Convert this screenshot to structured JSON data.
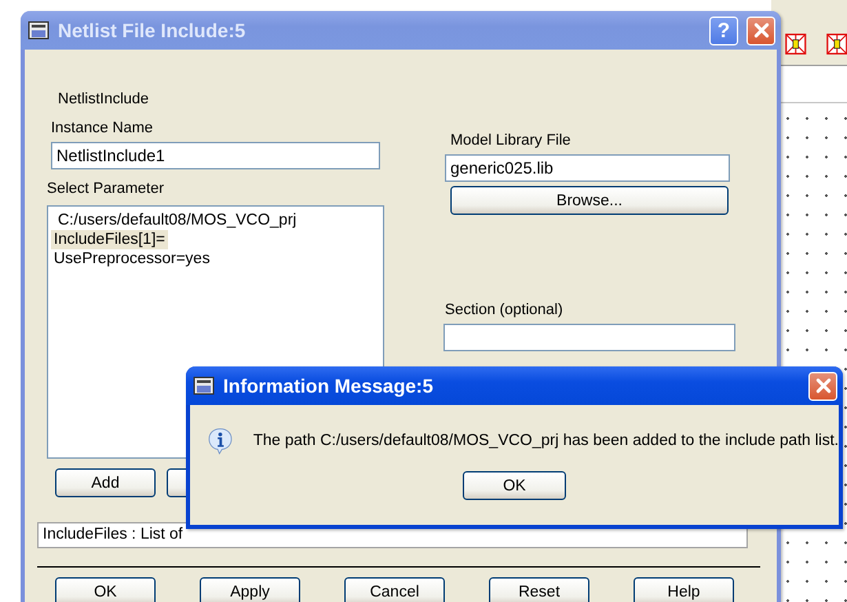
{
  "main_dialog": {
    "title": "Netlist File Include:5",
    "help_glyph": "?",
    "component": "NetlistInclude",
    "instance_name": {
      "label": "Instance Name",
      "value": "NetlistInclude1"
    },
    "select_parameter": {
      "label": "Select Parameter",
      "items": [
        {
          "text": "C:/users/default08/MOS_VCO_prj",
          "selected": false
        },
        {
          "text": "IncludeFiles[1]=",
          "selected": true
        },
        {
          "text": "UsePreprocessor=yes",
          "selected": false
        }
      ]
    },
    "list_buttons": [
      "Add"
    ],
    "model_library_file": {
      "label": "Model Library File",
      "value": "generic025.lib",
      "button": "Browse..."
    },
    "section": {
      "label": "Section (optional)"
    },
    "status_text": "IncludeFiles : List of",
    "buttons": [
      "OK",
      "Apply",
      "Cancel",
      "Reset",
      "Help"
    ]
  },
  "info_message": {
    "title": "Information Message:5",
    "text": "The path C:/users/default08/MOS_VCO_prj has been added to the include path list.",
    "button": "OK"
  }
}
